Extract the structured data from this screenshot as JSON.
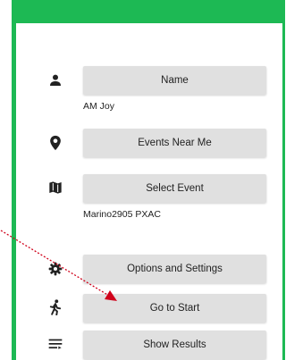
{
  "colors": {
    "accent": "#1db954",
    "button_bg": "#e0e0e0",
    "annotation": "#d0021b"
  },
  "menu": {
    "name": {
      "icon": "person-icon",
      "label": "Name",
      "value": "AM Joy"
    },
    "events_near_me": {
      "icon": "location-pin-icon",
      "label": "Events Near Me"
    },
    "select_event": {
      "icon": "map-icon",
      "label": "Select Event",
      "value": "Marino2905 PXAC"
    },
    "options": {
      "icon": "gear-icon",
      "label": "Options and Settings"
    },
    "go_to_start": {
      "icon": "runner-icon",
      "label": "Go to Start"
    },
    "show_results": {
      "icon": "list-icon",
      "label": "Show Results"
    }
  }
}
